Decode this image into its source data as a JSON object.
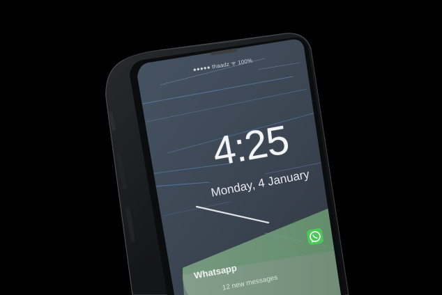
{
  "status_bar": {
    "carrier_text": "●●●●● thaadz ᯤ 100%"
  },
  "lock_screen": {
    "time": "4:25",
    "date": "Monday, 4 January"
  },
  "notification": {
    "app_name": "Whatsapp",
    "body": "12 new messages",
    "icon": "whatsapp-icon",
    "accent": "#6fbf73"
  },
  "colors": {
    "background": "#000000",
    "bezel": "#1a1b1d",
    "screen": "#3c4651",
    "streak": "#5c87c2"
  }
}
